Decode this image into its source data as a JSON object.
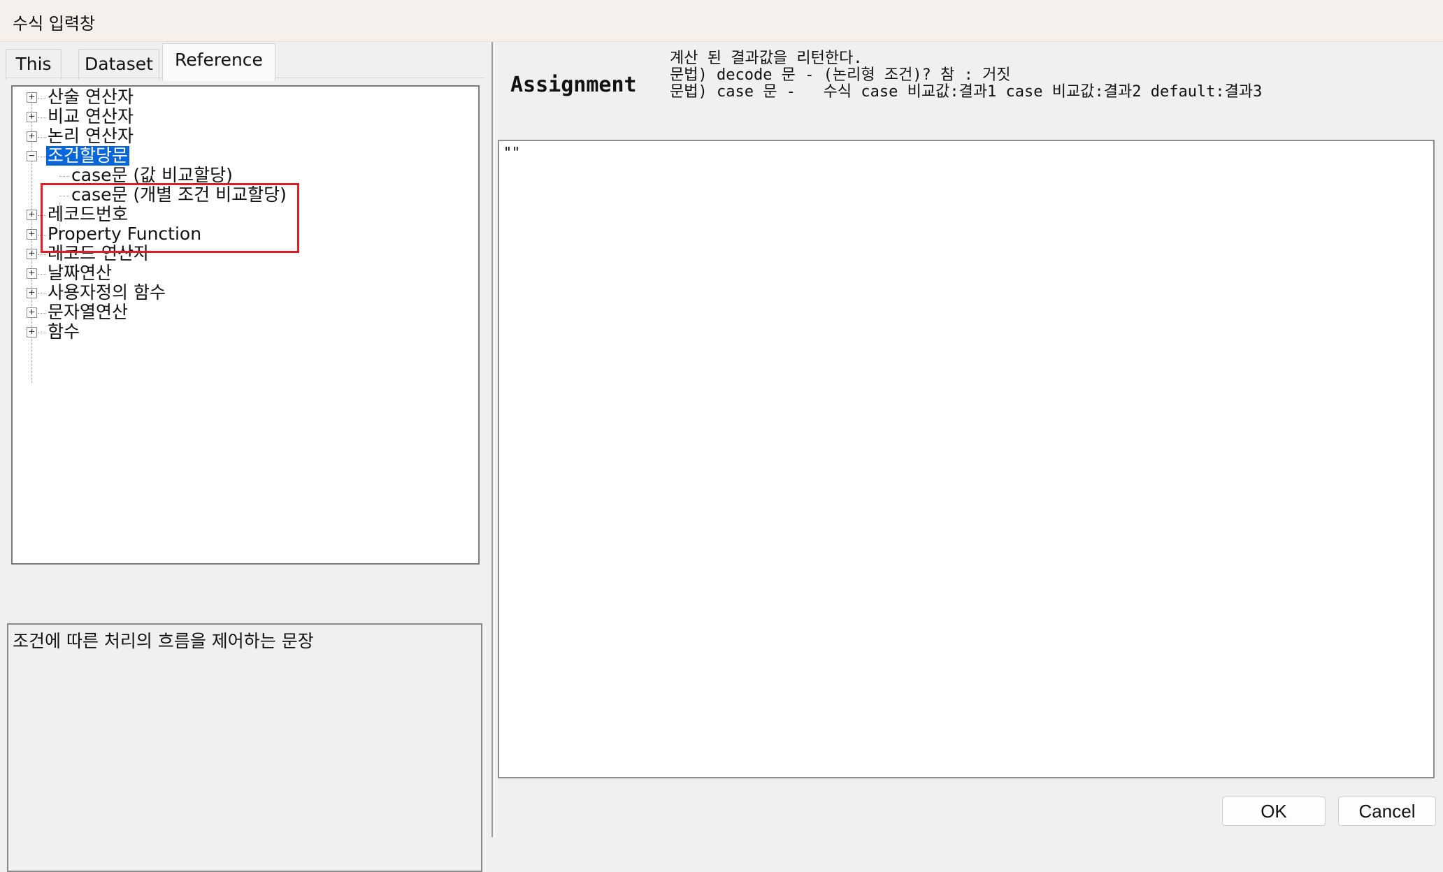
{
  "window": {
    "title": "수식 입력창"
  },
  "tabs": [
    {
      "label": "This",
      "active": false
    },
    {
      "label": "Dataset",
      "active": false
    },
    {
      "label": "Reference",
      "active": true
    }
  ],
  "tree": {
    "items": [
      {
        "label": "산술 연산자",
        "state": "collapsed"
      },
      {
        "label": "비교 연산자",
        "state": "collapsed"
      },
      {
        "label": "논리 연산자",
        "state": "collapsed"
      },
      {
        "label": "조건할당문",
        "state": "expanded",
        "selected": true,
        "children": [
          {
            "label": "case문 (값 비교할당)"
          },
          {
            "label": "case문 (개별 조건 비교할당)"
          }
        ]
      },
      {
        "label": "레코드번호",
        "state": "collapsed"
      },
      {
        "label": "Property Function",
        "state": "collapsed"
      },
      {
        "label": "레코드 연산자",
        "state": "collapsed"
      },
      {
        "label": "날짜연산",
        "state": "collapsed"
      },
      {
        "label": "사용자정의 함수",
        "state": "collapsed"
      },
      {
        "label": "문자열연산",
        "state": "collapsed"
      },
      {
        "label": "함수",
        "state": "collapsed"
      }
    ],
    "expand_symbol": "+",
    "collapse_symbol": "−"
  },
  "description": {
    "text": "조건에 따른 처리의 흐름을 제어하는 문장"
  },
  "info": {
    "title": "Assignment",
    "lines": [
      "계산 된 결과값을 리턴한다.",
      "문법) decode 문 - (논리형 조건)? 참 : 거짓",
      "문법) case 문 -   수식 case 비교값:결과1 case 비교값:결과2 default:결과3"
    ]
  },
  "editor": {
    "value": "\"\""
  },
  "buttons": {
    "ok": "OK",
    "cancel": "Cancel"
  },
  "colors": {
    "selection": "#0a66d8",
    "highlight_box": "#e31b23"
  }
}
